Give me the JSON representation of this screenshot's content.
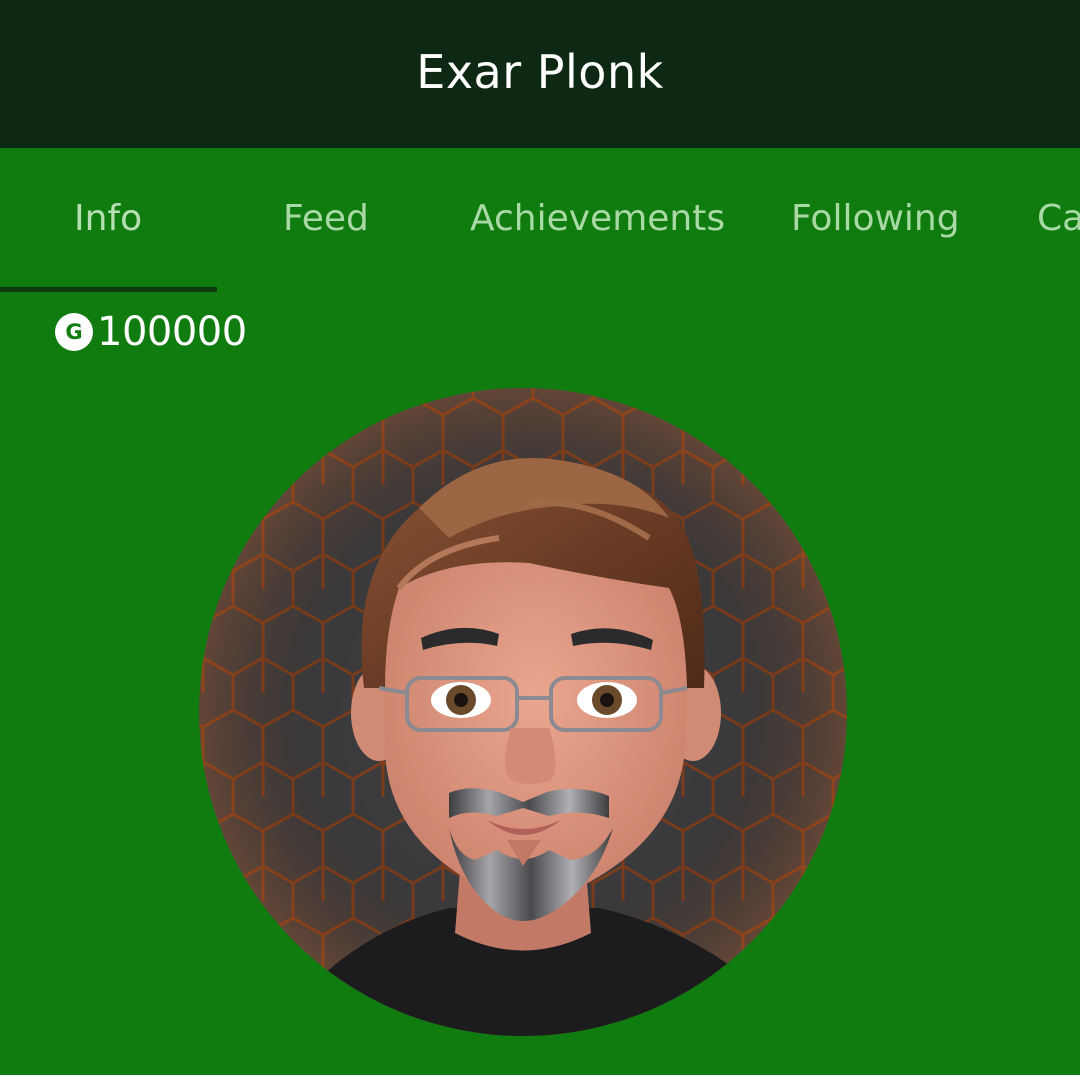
{
  "header": {
    "title": "Exar Plonk"
  },
  "tabs": [
    {
      "label": "Info",
      "active": true
    },
    {
      "label": "Feed",
      "active": false
    },
    {
      "label": "Achievements",
      "active": false
    },
    {
      "label": "Following",
      "active": false
    },
    {
      "label": "Ca",
      "active": false
    }
  ],
  "profile": {
    "gamerscore_icon_letter": "G",
    "gamerscore_icon": "gamerscore-icon",
    "gamerscore": "100000",
    "avatar": "avatar-image"
  },
  "colors": {
    "header_bg": "#0e2913",
    "page_bg": "#107c10",
    "tab_text": "#a9d9a4",
    "active_underline": "#0e3a12",
    "avatar_bg": "#3b3b3e",
    "hex_glow": "#d9641c"
  }
}
